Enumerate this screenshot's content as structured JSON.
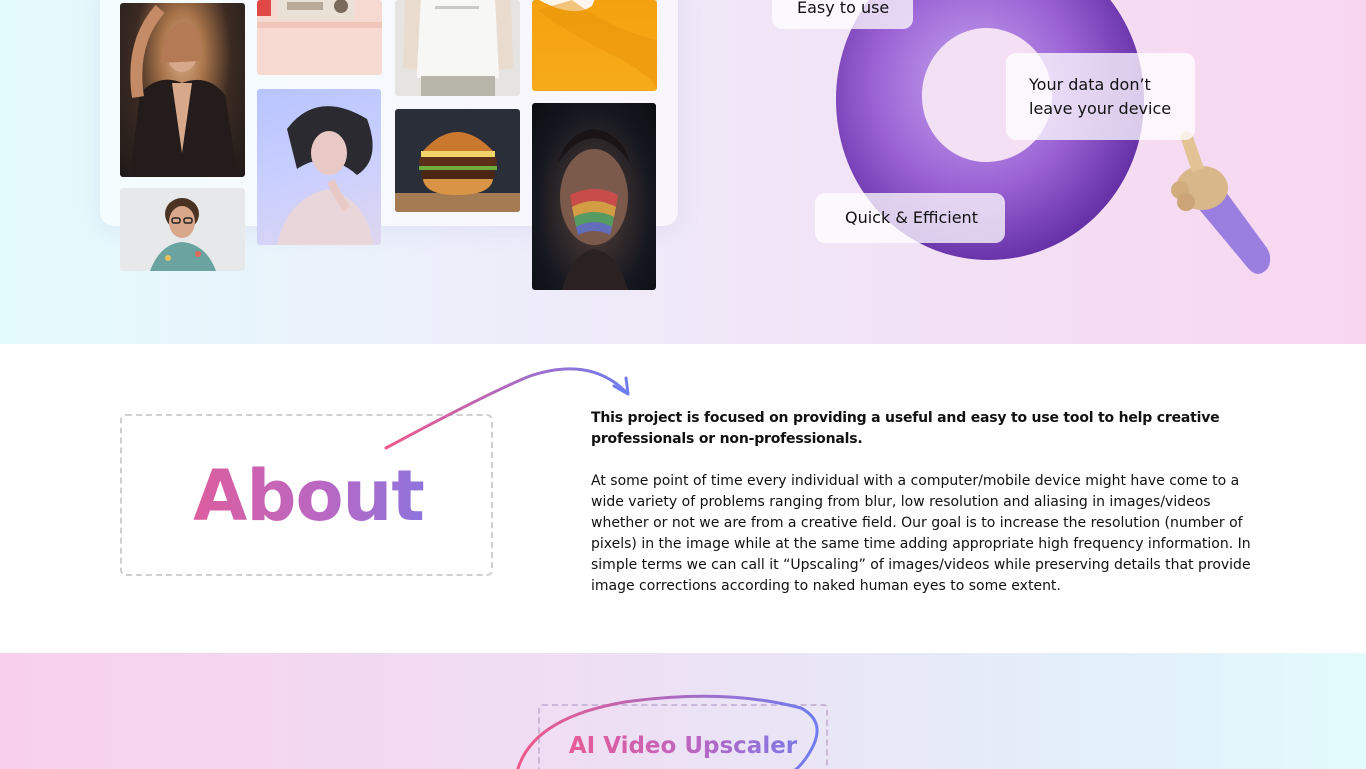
{
  "hero": {
    "features": {
      "easy": "Easy to use",
      "data": "Your data don’t leave your device",
      "quick": "Quick & Efficient"
    },
    "gallery": [
      {
        "name": "woman-leather-jacket-photo"
      },
      {
        "name": "smiling-man-glasses-photo"
      },
      {
        "name": "retro-radio-photo"
      },
      {
        "name": "woman-black-hair-3d-photo"
      },
      {
        "name": "white-tshirt-photo"
      },
      {
        "name": "burger-photo"
      },
      {
        "name": "yellow-object-photo"
      },
      {
        "name": "rainbow-face-photo"
      }
    ],
    "colors": {
      "donut": "#8a4bc8",
      "sleeve": "#9b7fe0"
    }
  },
  "about": {
    "title": "About",
    "lead": "This project is focused on providing a useful and easy to use tool to help creative professionals or non-professionals.",
    "body": "At some point of time every individual with a computer/mobile device might have come to a wide variety of problems ranging from blur, low resolution and aliasing in images/videos whether or not we are from a creative field. Our goal is to increase the resolution (number of pixels) in the image while at the same time adding appropriate high frequency information. In simple terms we can call it “Upscaling” of images/videos while preserving details that provide image corrections according to naked human eyes to some extent."
  },
  "upscaler": {
    "title": "AI Video Upscaler"
  },
  "colors": {
    "gradient_start": "#f0588a",
    "gradient_end": "#6f7cf0"
  }
}
